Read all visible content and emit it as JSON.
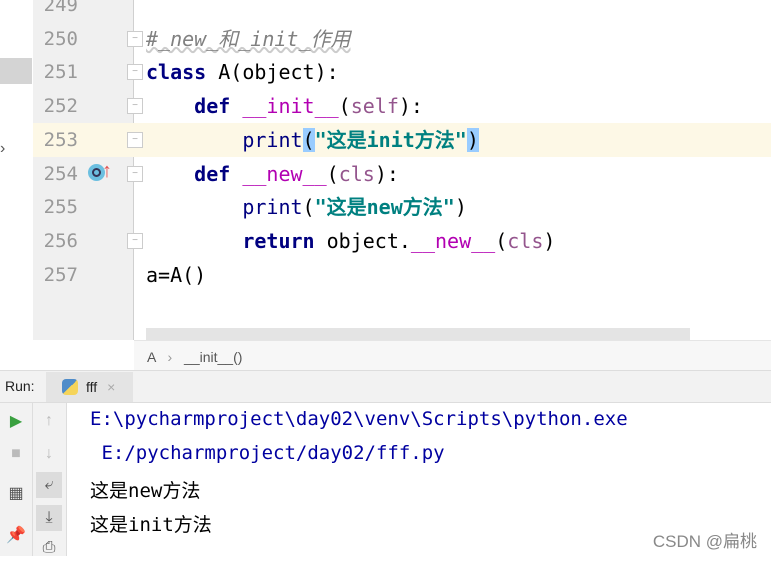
{
  "editor": {
    "lines": [
      {
        "num": "249",
        "tokens": []
      },
      {
        "num": "250",
        "tokens": [
          [
            "#_new_和_init_作用",
            "cm"
          ]
        ]
      },
      {
        "num": "251",
        "tokens": [
          [
            "class",
            "kw"
          ],
          [
            " A(object):",
            "pl"
          ]
        ]
      },
      {
        "num": "252",
        "tokens": [
          [
            "    ",
            "pl"
          ],
          [
            "def",
            "kw"
          ],
          [
            " ",
            "pl"
          ],
          [
            "__init__",
            "fn"
          ],
          [
            "(",
            "pl"
          ],
          [
            "self",
            "slf"
          ],
          [
            "):",
            "pl"
          ]
        ]
      },
      {
        "num": "253",
        "tokens": [
          [
            "        ",
            "pl"
          ],
          [
            "print",
            "bi"
          ],
          [
            "(",
            "br"
          ],
          [
            "\"这是init方法\"",
            "str"
          ],
          [
            ")",
            "br"
          ]
        ]
      },
      {
        "num": "254",
        "tokens": [
          [
            "    ",
            "pl"
          ],
          [
            "def",
            "kw"
          ],
          [
            " ",
            "pl"
          ],
          [
            "__new__",
            "fn"
          ],
          [
            "(",
            "pl"
          ],
          [
            "cls",
            "slf"
          ],
          [
            "):",
            "pl"
          ]
        ]
      },
      {
        "num": "255",
        "tokens": [
          [
            "        ",
            "pl"
          ],
          [
            "print",
            "bi"
          ],
          [
            "(",
            "pl"
          ],
          [
            "\"这是new方法\"",
            "str"
          ],
          [
            ")",
            "pl"
          ]
        ]
      },
      {
        "num": "256",
        "tokens": [
          [
            "        ",
            "pl"
          ],
          [
            "return",
            "kw"
          ],
          [
            " object.",
            "pl"
          ],
          [
            "__new__",
            "fn"
          ],
          [
            "(",
            "pl"
          ],
          [
            "cls",
            "slf"
          ],
          [
            ")",
            "pl"
          ]
        ]
      },
      {
        "num": "257",
        "tokens": [
          [
            "a=A()",
            "pl"
          ]
        ]
      }
    ]
  },
  "breadcrumb": {
    "class": "A",
    "sep": "›",
    "method": "__init__()"
  },
  "run": {
    "label": "Run:",
    "tab": "fff",
    "close": "×"
  },
  "console": {
    "lines": [
      "E:\\pycharmproject\\day02\\venv\\Scripts\\python.exe",
      " E:/pycharmproject/day02/fff.py",
      "这是new方法",
      "这是init方法"
    ]
  },
  "watermark": "CSDN @扁桃"
}
